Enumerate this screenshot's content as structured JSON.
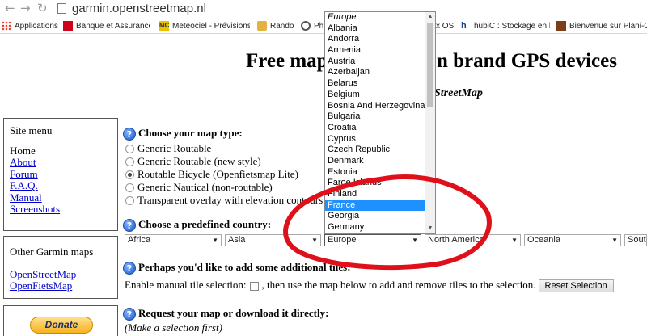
{
  "browser": {
    "url": "garmin.openstreetmap.nl",
    "nav": {
      "back": "←",
      "forward": "→",
      "reload": "↻"
    },
    "bookmarks": [
      {
        "label": "Applications",
        "icon": "apps-grid-icon",
        "color": "#4285f4"
      },
      {
        "label": "Banque et Assurances",
        "icon": "bank-icon",
        "color": "#d0021b"
      },
      {
        "label": "Meteociel - Prévisions",
        "icon": "meteociel-icon",
        "color": "#e8c100"
      },
      {
        "label": "Rando",
        "icon": "folder-icon",
        "color": "#e3b341"
      },
      {
        "label": "Ph",
        "icon": "ph-icon",
        "color": "#555555"
      },
      {
        "label": "x OS",
        "icon": "os-icon",
        "color": "#777777"
      },
      {
        "label": "hubiC : Stockage en li",
        "icon": "hubic-icon",
        "color": "#1c4587"
      },
      {
        "label": "Bienvenue sur Plani-C",
        "icon": "plani-icon",
        "color": "#7a3e1b"
      }
    ]
  },
  "page": {
    "title_part1": "Free map",
    "title_part2": "n brand GPS devices",
    "subtitle": "StreetMap"
  },
  "site_menu": {
    "heading": "Site menu",
    "home": "Home",
    "links": [
      "About",
      "Forum",
      "F.A.Q.",
      "Manual",
      "Screenshots"
    ]
  },
  "other_maps": {
    "heading": "Other Garmin maps",
    "links": [
      "OpenStreetMap",
      "OpenFietsMap"
    ]
  },
  "donate": {
    "label": "Donate"
  },
  "map_type": {
    "heading": "Choose your map type:",
    "options": [
      {
        "label": "Generic Routable",
        "checked": false
      },
      {
        "label": "Generic Routable (new style)",
        "checked": false
      },
      {
        "label": "Routable Bicycle (Openfietsmap Lite)",
        "checked": true
      },
      {
        "label": "Generic Nautical (non-routable)",
        "checked": false
      },
      {
        "label": "Transparent overlay with elevation contours",
        "checked": false
      }
    ]
  },
  "country": {
    "heading": "Choose a predefined country:",
    "selects": [
      "Africa",
      "Asia",
      "Europe",
      "North America",
      "Oceania",
      "South"
    ]
  },
  "tiles": {
    "heading": "Perhaps you'd like to add some additional tiles:",
    "enable_label": "Enable manual tile selection:",
    "after_checkbox": ", then use the map below to add and remove tiles to the selection.",
    "reset_button": "Reset Selection"
  },
  "request": {
    "heading": "Request your map or download it directly:",
    "note": "(Make a selection first)"
  },
  "dropdown": {
    "group_label": "Europe",
    "items": [
      "Albania",
      "Andorra",
      "Armenia",
      "Austria",
      "Azerbaijan",
      "Belarus",
      "Belgium",
      "Bosnia And Herzegovina",
      "Bulgaria",
      "Croatia",
      "Cyprus",
      "Czech Republic",
      "Denmark",
      "Estonia",
      "Faroe Islands",
      "Finland",
      "France",
      "Georgia",
      "Germany"
    ],
    "selected": "France"
  },
  "colors": {
    "highlight": "#1e90ff",
    "annotation": "#e0101a",
    "link": "#0000cc"
  }
}
